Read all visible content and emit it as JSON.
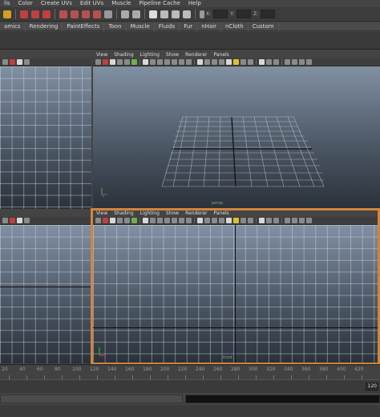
{
  "menubar": {
    "items": [
      "lis",
      "Color",
      "Create UVs",
      "Edit UVs",
      "Muscle",
      "Pipeline Cache",
      "Help"
    ]
  },
  "toolbar": {
    "x_label": "X:",
    "y_label": "Y:",
    "z_label": "Z:"
  },
  "shelf_tabs": [
    "amics",
    "Rendering",
    "PaintEffects",
    "Toon",
    "Muscle",
    "Fluids",
    "Fur",
    "nHair",
    "nCloth",
    "Custom"
  ],
  "viewport_menu": [
    "View",
    "Shading",
    "Lighting",
    "Show",
    "Renderer",
    "Panels"
  ],
  "persp_camera_label": "persp",
  "front_camera_label": "front",
  "timeline": {
    "ticks": [
      "20",
      "40",
      "60",
      "80",
      "100",
      "120",
      "140",
      "160",
      "180",
      "200",
      "220",
      "240",
      "260",
      "280",
      "300",
      "320",
      "340",
      "360",
      "380",
      "400",
      "420"
    ]
  },
  "range": {
    "value": "120"
  },
  "colors": {
    "viewport_top": "#8190a3",
    "viewport_bottom": "#2a313a",
    "highlight": "#d2843c",
    "grid_line": "#d2dce6"
  }
}
